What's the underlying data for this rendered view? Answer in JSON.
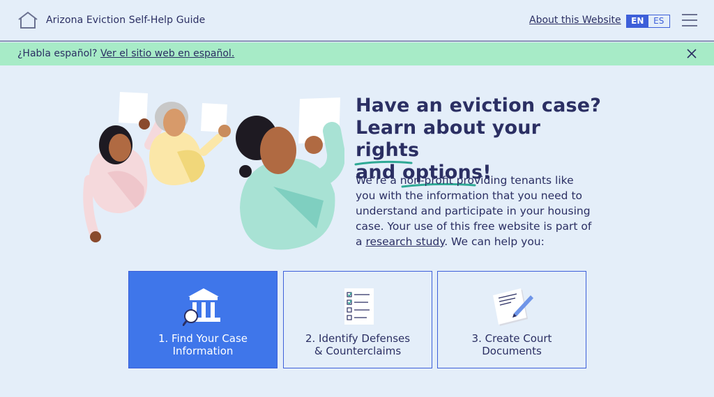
{
  "header": {
    "home_icon": "home-icon",
    "site_title": "Arizona Eviction Self-Help Guide",
    "about_link": "About this Website",
    "languages": [
      {
        "code": "EN",
        "active": true
      },
      {
        "code": "ES",
        "active": false
      }
    ],
    "menu_icon": "hamburger-menu-icon"
  },
  "banner": {
    "prompt": "¿Habla español?",
    "link_text": "Ver el sitio web en español.",
    "close_icon": "close-icon"
  },
  "hero": {
    "heading_line1": "Have an eviction case?",
    "heading_line2_pre": "Learn about your ",
    "heading_rights": "rights",
    "heading_line3_pre": "and ",
    "heading_options": "options",
    "heading_line3_post": "!",
    "body_pre": "We’re a non-profit providing tenants like you with the information that you need to understand and participate in your housing case. Your use of this free website is part of a ",
    "body_link": "research study",
    "body_post": ". We can help you:"
  },
  "cards": [
    {
      "line1": "1. Find Your Case",
      "line2": "Information",
      "icon": "courthouse-magnifier-icon"
    },
    {
      "line1": "2. Identify Defenses",
      "line2": "& Counterclaims",
      "icon": "checklist-icon"
    },
    {
      "line1": "3. Create Court",
      "line2": "Documents",
      "icon": "document-pen-icon"
    }
  ],
  "colors": {
    "page_background": "#e4eef9",
    "banner_background": "#a7ebc7",
    "primary_blue": "#3f76ea",
    "text_navy": "#2b2f63",
    "underline_teal": "#2fa995"
  }
}
